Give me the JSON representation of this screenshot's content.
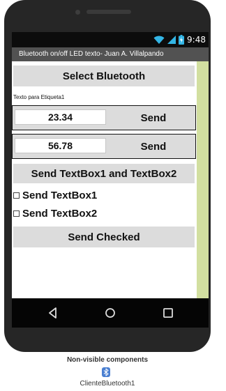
{
  "status": {
    "time": "9:48",
    "icons": [
      "wifi-icon",
      "signal-icon",
      "battery-charging-icon"
    ]
  },
  "app": {
    "title": "Bluetooth on/off LED texto- Juan A. Villalpando"
  },
  "main": {
    "select_bluetooth_label": "Select Bluetooth",
    "label_text": "Texto para Etiqueta1",
    "textbox1": {
      "value": "23.34",
      "send_label": "Send"
    },
    "textbox2": {
      "value": "56.78",
      "send_label": "Send"
    },
    "send_both_label": "Send TextBox1 and TextBox2",
    "checkbox1": {
      "label": "Send TextBox1",
      "checked": false
    },
    "checkbox2": {
      "label": "Send TextBox2",
      "checked": false
    },
    "send_checked_label": "Send Checked"
  },
  "navbar": {
    "icons": [
      "back-icon",
      "home-icon",
      "recents-icon"
    ]
  },
  "nonvisible": {
    "title": "Non-visible components",
    "component_icon": "bluetooth-icon",
    "component_name": "ClienteBluetooth1"
  },
  "colors": {
    "accent": "#d2dfa0",
    "button_bg": "#dcdcdc",
    "titlebar": "#525252",
    "status_icons": "#33b5e5"
  }
}
